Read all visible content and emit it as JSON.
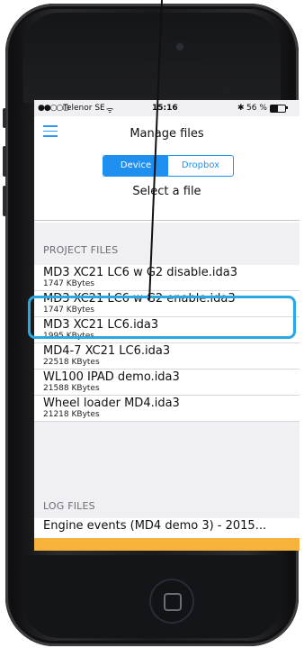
{
  "status": {
    "carrier": "Telenor SE",
    "signal_dots": "●●○○○",
    "time": "15:16",
    "battery": "56 %",
    "bluetooth_glyph": "✱",
    "wifi_glyph": "ᯤ"
  },
  "nav": {
    "title": "Manage files"
  },
  "segmented": {
    "device_label": "Device",
    "dropbox_label": "Dropbox"
  },
  "main": {
    "select_title": "Select a file"
  },
  "project_files": {
    "header": "PROJECT FILES",
    "items": [
      {
        "name": "MD3 XC21 LC6 w G2 disable.ida3",
        "size": "1747 KBytes"
      },
      {
        "name": "MD3 XC21 LC6 w G2 enable.ida3",
        "size": "1747 KBytes"
      },
      {
        "name": "MD3 XC21 LC6.ida3",
        "size": "1995 KBytes"
      },
      {
        "name": "MD4-7 XC21 LC6.ida3",
        "size": "22518 KBytes"
      },
      {
        "name": "WL100 IPAD demo.ida3",
        "size": "21588 KBytes"
      },
      {
        "name": "Wheel loader MD4.ida3",
        "size": "21218 KBytes"
      }
    ]
  },
  "log_files": {
    "header": "LOG FILES",
    "items": [
      {
        "name": "Engine events (MD4 demo 3)  - 2015..."
      }
    ]
  },
  "colors": {
    "accent": "#1f8ff0",
    "highlight": "#29a9df",
    "bottom_bar": "#f6b23a"
  }
}
